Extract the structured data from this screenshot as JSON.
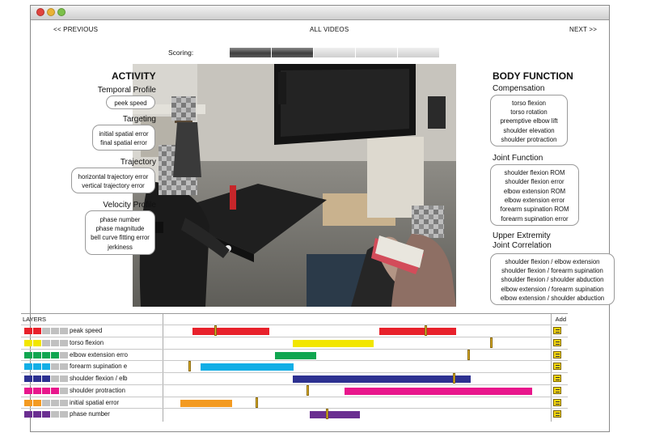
{
  "nav": {
    "previous": "<< PREVIOUS",
    "all_videos": "ALL VIDEOS",
    "next": "NEXT >>"
  },
  "scoring": {
    "label": "Scoring:",
    "segments": [
      "filled",
      "filled",
      "empty",
      "empty",
      "empty"
    ]
  },
  "activity": {
    "title": "ACTIVITY",
    "groups": [
      {
        "label": "Temporal Profile",
        "items": [
          "peek speed"
        ]
      },
      {
        "label": "Targeting",
        "items": [
          "initial spatial error",
          "final spatial error"
        ]
      },
      {
        "label": "Trajectory",
        "items": [
          "horizontal trajectory error",
          "vertical trajectory error"
        ]
      },
      {
        "label": "Velocity Profile",
        "items": [
          "phase number",
          "phase magnitude",
          "bell curve fitting error",
          "jerkiness"
        ]
      }
    ]
  },
  "body_function": {
    "title": "BODY FUNCTION",
    "groups": [
      {
        "label": "Compensation",
        "items": [
          "torso flexion",
          "torso rotation",
          "preemptive elbow lift",
          "shoulder elevation",
          "shoulder protraction"
        ]
      },
      {
        "label": "Joint Function",
        "items": [
          "shoulder flexion ROM",
          "shoulder flexion error",
          "elbow extension ROM",
          "elbow extension error",
          "forearm supination ROM",
          "forearm supination error"
        ]
      },
      {
        "label": "Upper Extremity",
        "label2": "Joint Correlation",
        "items": [
          "shoulder flexion / elbow extension",
          "shoulder flexion / forearm supination",
          "shoulder flexion / shoulder abduction",
          "elbow extension / forearm supination",
          "elbow extension / shoulder abduction"
        ]
      }
    ]
  },
  "layers": {
    "header": "LAYERS",
    "add_label": "Add",
    "rows": [
      {
        "label": "peak speed",
        "color": "#e8212b",
        "filled": 2
      },
      {
        "label": "torso flexion",
        "color": "#f2e600",
        "filled": 2
      },
      {
        "label": "elbow extension erro",
        "color": "#10a650",
        "filled": 4
      },
      {
        "label": "forearm supination e",
        "color": "#12aee6",
        "filled": 3
      },
      {
        "label": "shoulder flexion / elb",
        "color": "#2d3191",
        "filled": 3
      },
      {
        "label": "shoulder protraction",
        "color": "#e8168c",
        "filled": 4
      },
      {
        "label": "initial spatial error",
        "color": "#f39a21",
        "filled": 2
      },
      {
        "label": "phase number",
        "color": "#6a2e91",
        "filled": 3
      }
    ]
  },
  "timeline": {
    "rows": [
      {
        "segments": [
          [
            0.073,
            0.273
          ],
          [
            0.558,
            0.758
          ]
        ],
        "markers": [
          0.13,
          0.676
        ]
      },
      {
        "segments": [
          [
            0.333,
            0.545
          ]
        ],
        "markers": [
          0.846
        ]
      },
      {
        "segments": [
          [
            0.287,
            0.396
          ]
        ],
        "markers": [
          0.788
        ]
      },
      {
        "segments": [
          [
            0.094,
            0.336
          ]
        ],
        "markers": [
          0.063
        ]
      },
      {
        "segments": [
          [
            0.333,
            0.797
          ]
        ],
        "markers": [
          0.75
        ]
      },
      {
        "segments": [
          [
            0.469,
            0.955
          ]
        ],
        "markers": [
          0.37
        ]
      },
      {
        "segments": [
          [
            0.042,
            0.176
          ]
        ],
        "markers": [
          0.237
        ]
      },
      {
        "segments": [
          [
            0.378,
            0.509
          ]
        ],
        "markers": [
          0.42
        ]
      }
    ]
  }
}
